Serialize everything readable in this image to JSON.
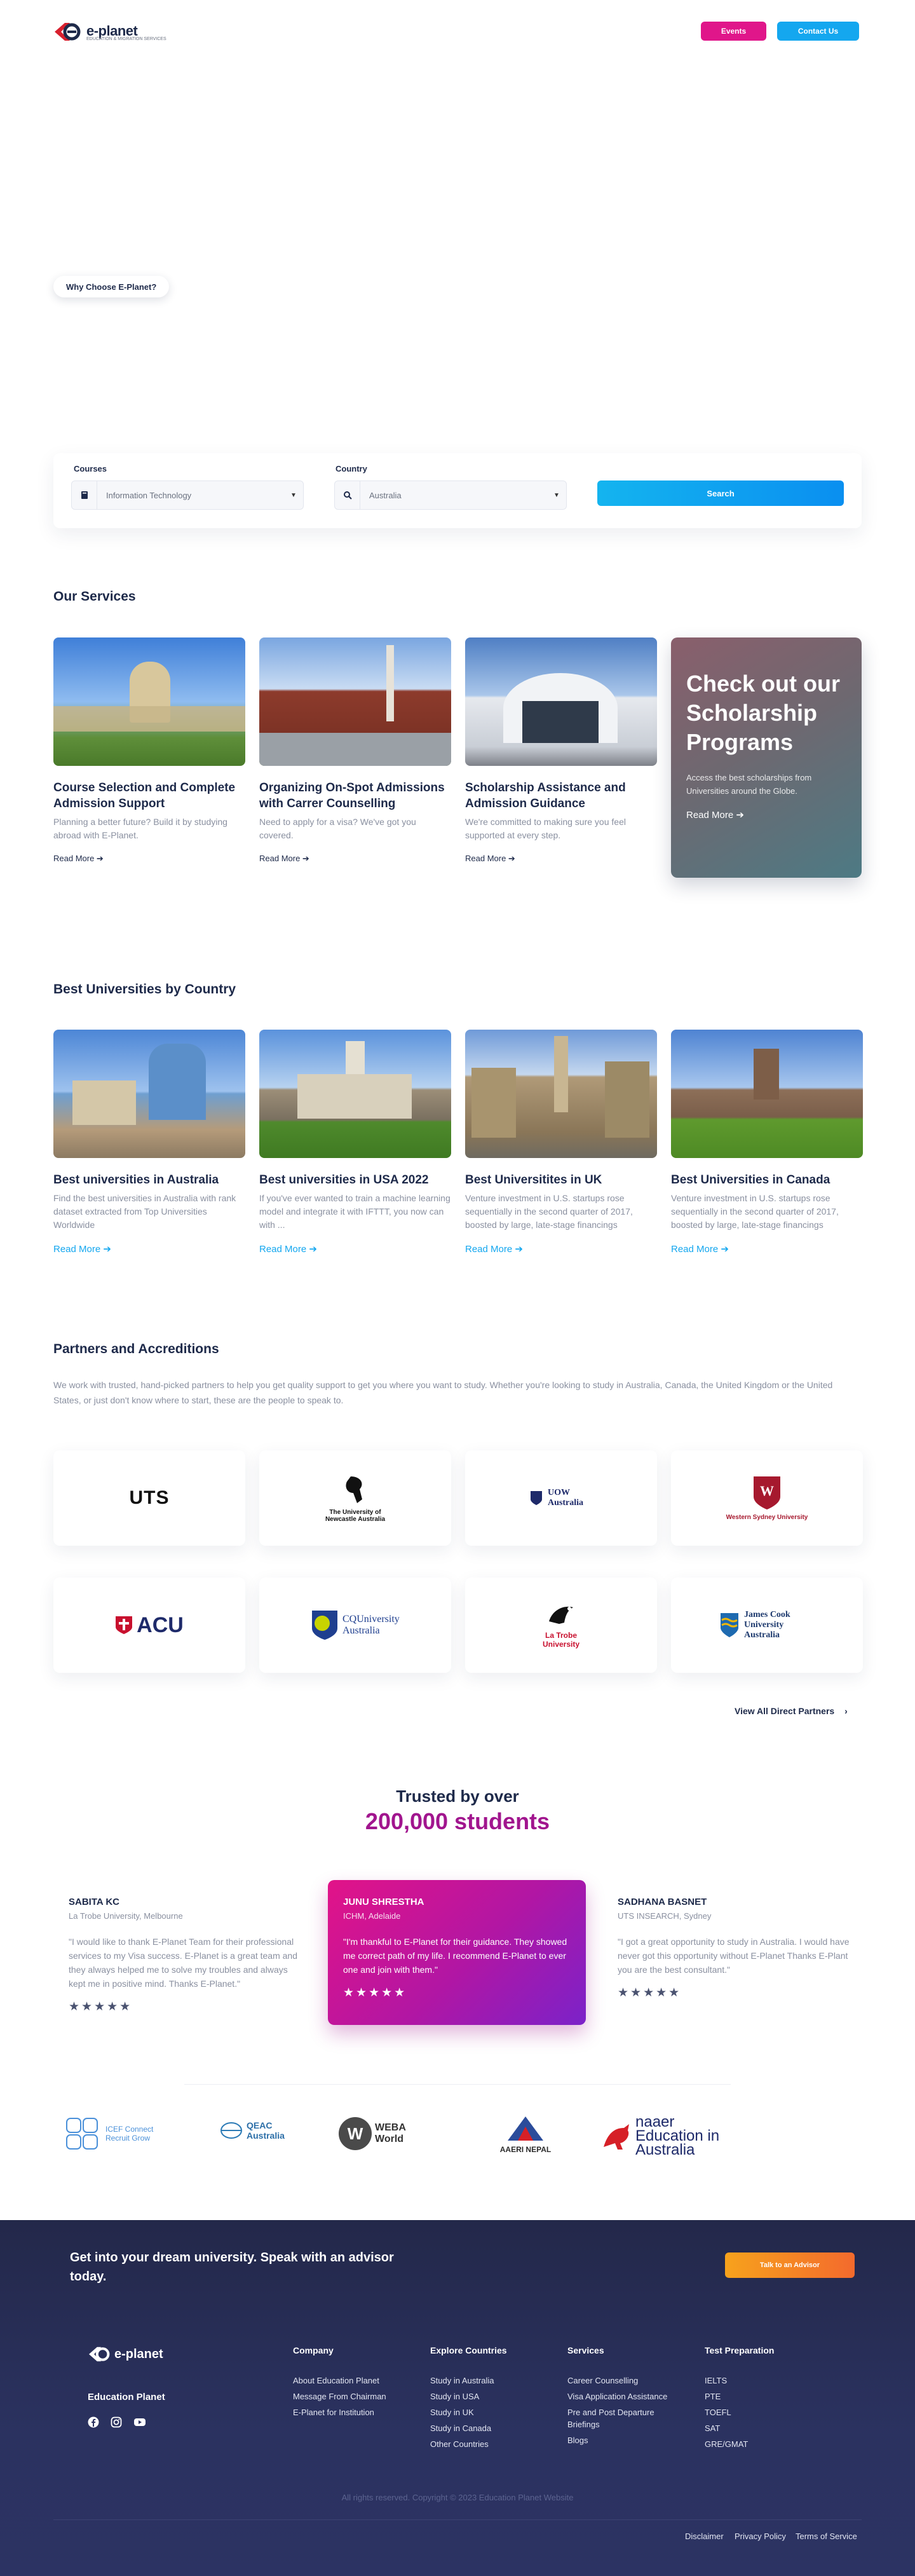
{
  "header": {
    "logo_text": "e-planet",
    "logo_sub": "EDUCATION & MIGRATION SERVICES",
    "events_label": "Events",
    "contact_label": "Contact Us"
  },
  "hero": {
    "pill_label": "Why Choose E-Planet?"
  },
  "search": {
    "courses_label": "Courses",
    "courses_value": "Information Technology",
    "country_label": "Country",
    "country_value": "Australia",
    "button_label": "Search"
  },
  "services": {
    "title": "Our Services",
    "items": [
      {
        "title": "Course Selection and Complete Admission Support",
        "desc": "Planning a better future? Build it by studying abroad with E-Planet.",
        "link": "Read More"
      },
      {
        "title": "Organizing On-Spot Admissions with Carrer Counselling",
        "desc": "Need to apply for a visa? We've got you covered.",
        "link": "Read More"
      },
      {
        "title": "Scholarship Assistance and Admission Guidance",
        "desc": "We're committed to making sure you feel supported at every step.",
        "link": "Read More"
      }
    ],
    "promo": {
      "title": "Check out our Scholarship Programs",
      "desc": "Access the best scholarships from Universities around the Globe.",
      "link": "Read More"
    }
  },
  "universities": {
    "title": "Best Universities by Country",
    "items": [
      {
        "title": "Best universities in Australia",
        "desc": "Find the best universities in Australia with rank dataset extracted from Top Universities Worldwide",
        "link": "Read More"
      },
      {
        "title": "Best universities in USA 2022",
        "desc": "If you've ever wanted to train a machine learning model and integrate it with IFTTT, you now can with ...",
        "link": "Read More"
      },
      {
        "title": "Best Universitites in UK",
        "desc": "Venture investment in U.S. startups rose sequentially in the second quarter of 2017, boosted by large, late-stage financings",
        "link": "Read More"
      },
      {
        "title": "Best Universities in Canada",
        "desc": "Venture investment in U.S. startups rose sequentially in the second quarter of 2017, boosted by large, late-stage financings",
        "link": "Read More"
      }
    ]
  },
  "partners": {
    "title": "Partners and Accreditions",
    "intro": "We work with trusted, hand-picked partners to help you get quality support to get you where you want to study. Whether you're looking to study in Australia, Canada, the United Kingdom or the United States, or just don't know where to start, these are the people to speak to.",
    "logos": [
      "UTS",
      "The University of Newcastle Australia",
      "UOW Australia",
      "Western Sydney University",
      "ACU",
      "CQUniversity Australia",
      "La Trobe University",
      "James Cook University Australia"
    ],
    "view_all": "View All Direct Partners"
  },
  "trusted": {
    "line1": "Trusted by over",
    "line2": "200,000 students",
    "testimonials": [
      {
        "name": "SABITA KC",
        "org": "La Trobe University, Melbourne",
        "quote": "\"I would like to thank E-Planet Team for their professional services to my Visa success. E-Planet is a great team and they always helped me to solve my troubles and always kept me in positive mind. Thanks E-Planet.\"",
        "stars": "★★★★★"
      },
      {
        "name": "JUNU SHRESTHA",
        "org": "ICHM, Adelaide",
        "quote": "\"I'm thankful to E-Planet for their guidance. They showed me correct path of my life. I recommend E-Planet to ever one and join with them.\"",
        "stars": "★★★★★"
      },
      {
        "name": "SADHANA BASNET",
        "org": "UTS INSEARCH, Sydney",
        "quote": "\"I got a great opportunity to study in Australia. I would have never got this opportunity without E-Planet Thanks E-Plant you are the best consultant.\"",
        "stars": "★★★★★"
      }
    ]
  },
  "accreditations": [
    "ICEF Connect Recruit Grow",
    "QEAC Australia",
    "WEBA World",
    "AAERI NEPAL",
    "naaer Education in Australia"
  ],
  "footer": {
    "cta": "Get into your dream university. Speak with an advisor today.",
    "cta_button": "Talk to an Advisor",
    "brand_name": "Education Planet",
    "columns": [
      {
        "title": "Company",
        "items": [
          "About Education Planet",
          "Message From Chairman",
          "E-Planet for Institution"
        ]
      },
      {
        "title": "Explore Countries",
        "items": [
          "Study in Australia",
          "Study in USA",
          "Study in UK",
          "Study in Canada",
          "Other Countries"
        ]
      },
      {
        "title": "Services",
        "items": [
          "Career Counselling",
          "Visa Application Assistance",
          "Pre and Post Departure Briefings",
          "Blogs"
        ]
      },
      {
        "title": "Test Preparation",
        "items": [
          "IELTS",
          "PTE",
          "TOEFL",
          "SAT",
          "GRE/GMAT"
        ]
      }
    ],
    "copyright": "All rights reserved. Copyright © 2023 Education Planet Website",
    "legal": [
      "Disclaimer",
      "Privacy Policy",
      "Terms of Service"
    ]
  },
  "colors": {
    "navy": "#1e2a4a",
    "magenta": "#e0168a",
    "sky": "#14a7ef",
    "orange": "#f36a2d"
  }
}
